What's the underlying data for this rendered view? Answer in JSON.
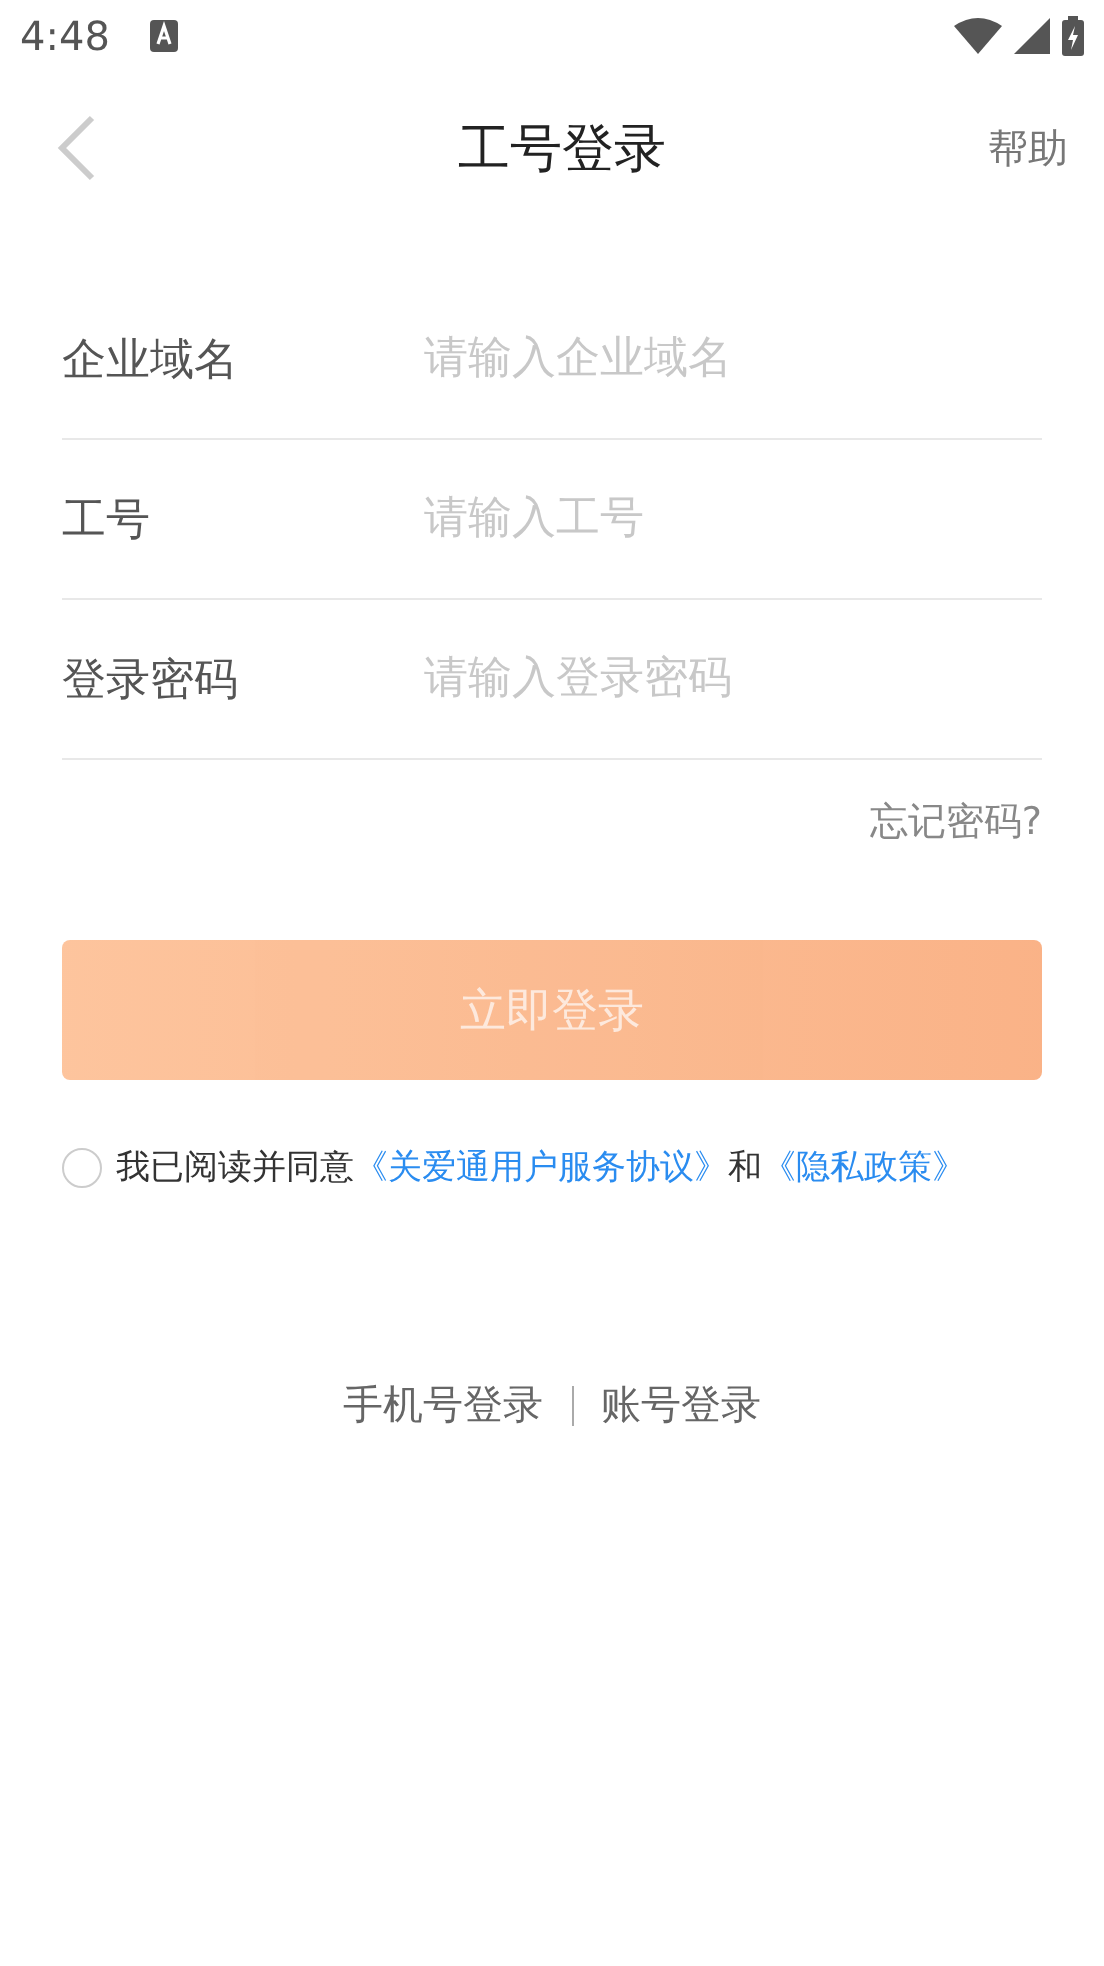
{
  "status_bar": {
    "time": "4:48"
  },
  "header": {
    "title": "工号登录",
    "action": "帮助"
  },
  "fields": [
    {
      "label": "企业域名",
      "placeholder": "请输入企业域名"
    },
    {
      "label": "工号",
      "placeholder": "请输入工号"
    },
    {
      "label": "登录密码",
      "placeholder": "请输入登录密码"
    }
  ],
  "forgot_link": "忘记密码?",
  "login_button": {
    "label": "立即登录",
    "disabled": true
  },
  "agreement": {
    "checked": false,
    "prefix": "我已阅读并同意",
    "terms_link": "《关爱通用户服务协议》",
    "joiner": "和",
    "privacy_link": "《隐私政策》"
  },
  "alt_logins": [
    {
      "label": "手机号登录"
    },
    {
      "label": "账号登录"
    }
  ]
}
